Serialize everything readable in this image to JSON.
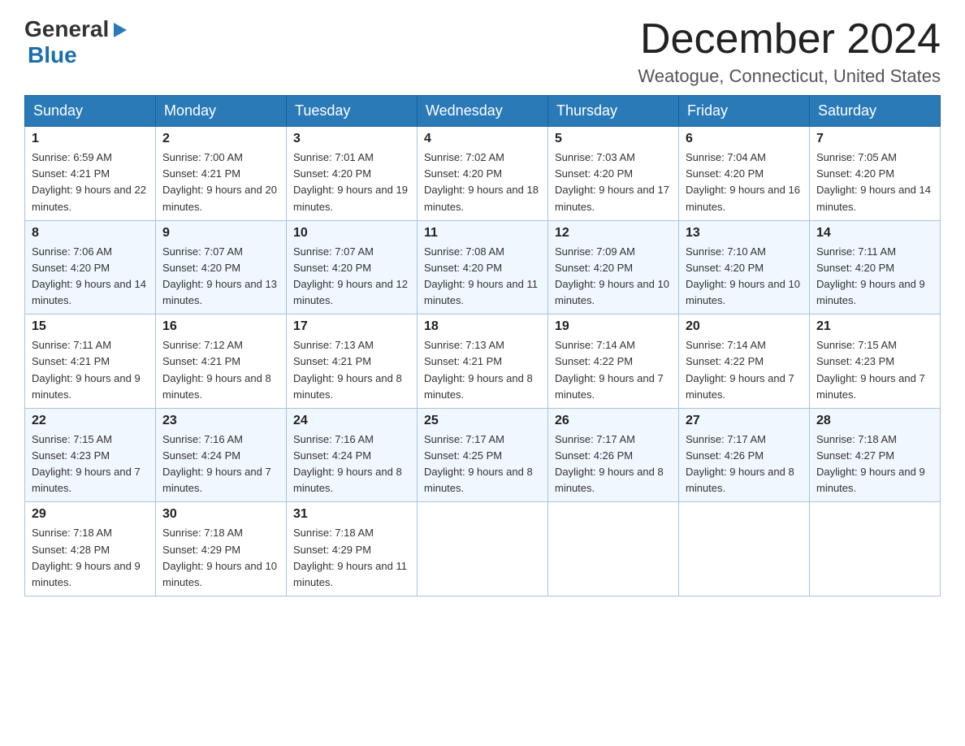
{
  "header": {
    "logo": {
      "general": "General",
      "triangle": "▶",
      "blue": "Blue"
    },
    "title": "December 2024",
    "location": "Weatogue, Connecticut, United States"
  },
  "days_of_week": [
    "Sunday",
    "Monday",
    "Tuesday",
    "Wednesday",
    "Thursday",
    "Friday",
    "Saturday"
  ],
  "weeks": [
    [
      {
        "day": "1",
        "sunrise": "Sunrise: 6:59 AM",
        "sunset": "Sunset: 4:21 PM",
        "daylight": "Daylight: 9 hours and 22 minutes."
      },
      {
        "day": "2",
        "sunrise": "Sunrise: 7:00 AM",
        "sunset": "Sunset: 4:21 PM",
        "daylight": "Daylight: 9 hours and 20 minutes."
      },
      {
        "day": "3",
        "sunrise": "Sunrise: 7:01 AM",
        "sunset": "Sunset: 4:20 PM",
        "daylight": "Daylight: 9 hours and 19 minutes."
      },
      {
        "day": "4",
        "sunrise": "Sunrise: 7:02 AM",
        "sunset": "Sunset: 4:20 PM",
        "daylight": "Daylight: 9 hours and 18 minutes."
      },
      {
        "day": "5",
        "sunrise": "Sunrise: 7:03 AM",
        "sunset": "Sunset: 4:20 PM",
        "daylight": "Daylight: 9 hours and 17 minutes."
      },
      {
        "day": "6",
        "sunrise": "Sunrise: 7:04 AM",
        "sunset": "Sunset: 4:20 PM",
        "daylight": "Daylight: 9 hours and 16 minutes."
      },
      {
        "day": "7",
        "sunrise": "Sunrise: 7:05 AM",
        "sunset": "Sunset: 4:20 PM",
        "daylight": "Daylight: 9 hours and 14 minutes."
      }
    ],
    [
      {
        "day": "8",
        "sunrise": "Sunrise: 7:06 AM",
        "sunset": "Sunset: 4:20 PM",
        "daylight": "Daylight: 9 hours and 14 minutes."
      },
      {
        "day": "9",
        "sunrise": "Sunrise: 7:07 AM",
        "sunset": "Sunset: 4:20 PM",
        "daylight": "Daylight: 9 hours and 13 minutes."
      },
      {
        "day": "10",
        "sunrise": "Sunrise: 7:07 AM",
        "sunset": "Sunset: 4:20 PM",
        "daylight": "Daylight: 9 hours and 12 minutes."
      },
      {
        "day": "11",
        "sunrise": "Sunrise: 7:08 AM",
        "sunset": "Sunset: 4:20 PM",
        "daylight": "Daylight: 9 hours and 11 minutes."
      },
      {
        "day": "12",
        "sunrise": "Sunrise: 7:09 AM",
        "sunset": "Sunset: 4:20 PM",
        "daylight": "Daylight: 9 hours and 10 minutes."
      },
      {
        "day": "13",
        "sunrise": "Sunrise: 7:10 AM",
        "sunset": "Sunset: 4:20 PM",
        "daylight": "Daylight: 9 hours and 10 minutes."
      },
      {
        "day": "14",
        "sunrise": "Sunrise: 7:11 AM",
        "sunset": "Sunset: 4:20 PM",
        "daylight": "Daylight: 9 hours and 9 minutes."
      }
    ],
    [
      {
        "day": "15",
        "sunrise": "Sunrise: 7:11 AM",
        "sunset": "Sunset: 4:21 PM",
        "daylight": "Daylight: 9 hours and 9 minutes."
      },
      {
        "day": "16",
        "sunrise": "Sunrise: 7:12 AM",
        "sunset": "Sunset: 4:21 PM",
        "daylight": "Daylight: 9 hours and 8 minutes."
      },
      {
        "day": "17",
        "sunrise": "Sunrise: 7:13 AM",
        "sunset": "Sunset: 4:21 PM",
        "daylight": "Daylight: 9 hours and 8 minutes."
      },
      {
        "day": "18",
        "sunrise": "Sunrise: 7:13 AM",
        "sunset": "Sunset: 4:21 PM",
        "daylight": "Daylight: 9 hours and 8 minutes."
      },
      {
        "day": "19",
        "sunrise": "Sunrise: 7:14 AM",
        "sunset": "Sunset: 4:22 PM",
        "daylight": "Daylight: 9 hours and 7 minutes."
      },
      {
        "day": "20",
        "sunrise": "Sunrise: 7:14 AM",
        "sunset": "Sunset: 4:22 PM",
        "daylight": "Daylight: 9 hours and 7 minutes."
      },
      {
        "day": "21",
        "sunrise": "Sunrise: 7:15 AM",
        "sunset": "Sunset: 4:23 PM",
        "daylight": "Daylight: 9 hours and 7 minutes."
      }
    ],
    [
      {
        "day": "22",
        "sunrise": "Sunrise: 7:15 AM",
        "sunset": "Sunset: 4:23 PM",
        "daylight": "Daylight: 9 hours and 7 minutes."
      },
      {
        "day": "23",
        "sunrise": "Sunrise: 7:16 AM",
        "sunset": "Sunset: 4:24 PM",
        "daylight": "Daylight: 9 hours and 7 minutes."
      },
      {
        "day": "24",
        "sunrise": "Sunrise: 7:16 AM",
        "sunset": "Sunset: 4:24 PM",
        "daylight": "Daylight: 9 hours and 8 minutes."
      },
      {
        "day": "25",
        "sunrise": "Sunrise: 7:17 AM",
        "sunset": "Sunset: 4:25 PM",
        "daylight": "Daylight: 9 hours and 8 minutes."
      },
      {
        "day": "26",
        "sunrise": "Sunrise: 7:17 AM",
        "sunset": "Sunset: 4:26 PM",
        "daylight": "Daylight: 9 hours and 8 minutes."
      },
      {
        "day": "27",
        "sunrise": "Sunrise: 7:17 AM",
        "sunset": "Sunset: 4:26 PM",
        "daylight": "Daylight: 9 hours and 8 minutes."
      },
      {
        "day": "28",
        "sunrise": "Sunrise: 7:18 AM",
        "sunset": "Sunset: 4:27 PM",
        "daylight": "Daylight: 9 hours and 9 minutes."
      }
    ],
    [
      {
        "day": "29",
        "sunrise": "Sunrise: 7:18 AM",
        "sunset": "Sunset: 4:28 PM",
        "daylight": "Daylight: 9 hours and 9 minutes."
      },
      {
        "day": "30",
        "sunrise": "Sunrise: 7:18 AM",
        "sunset": "Sunset: 4:29 PM",
        "daylight": "Daylight: 9 hours and 10 minutes."
      },
      {
        "day": "31",
        "sunrise": "Sunrise: 7:18 AM",
        "sunset": "Sunset: 4:29 PM",
        "daylight": "Daylight: 9 hours and 11 minutes."
      },
      null,
      null,
      null,
      null
    ]
  ]
}
